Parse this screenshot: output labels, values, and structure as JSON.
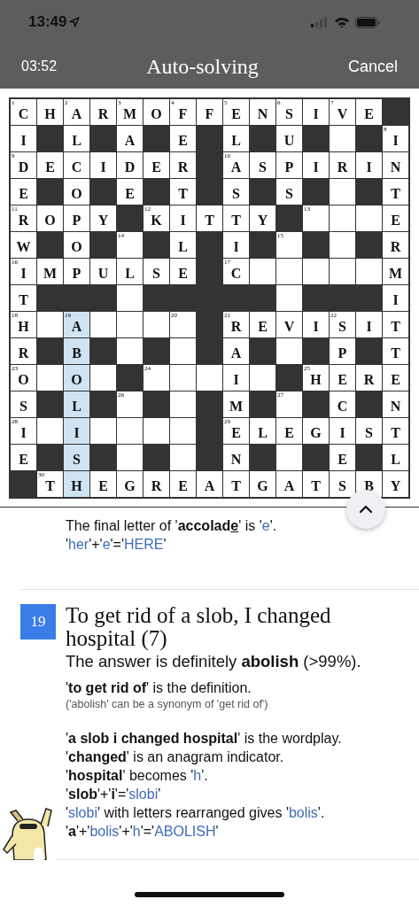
{
  "status_bar": {
    "time": "13:49"
  },
  "nav": {
    "timer": "03:52",
    "title": "Auto-solving",
    "cancel": "Cancel"
  },
  "grid": {
    "rows": [
      [
        {
          "kind": "cell",
          "letter": "C",
          "number": "1",
          "selected": false
        },
        {
          "kind": "cell",
          "letter": "H",
          "selected": false
        },
        {
          "kind": "cell",
          "letter": "A",
          "number": "2",
          "selected": false
        },
        {
          "kind": "cell",
          "letter": "R",
          "selected": false
        },
        {
          "kind": "cell",
          "letter": "M",
          "number": "3",
          "selected": false
        },
        {
          "kind": "cell",
          "letter": "O",
          "selected": false
        },
        {
          "kind": "cell",
          "letter": "F",
          "number": "4",
          "selected": false
        },
        {
          "kind": "cell",
          "letter": "F",
          "selected": false
        },
        {
          "kind": "cell",
          "letter": "E",
          "number": "5",
          "selected": false
        },
        {
          "kind": "cell",
          "letter": "N",
          "selected": false
        },
        {
          "kind": "cell",
          "letter": "S",
          "number": "6",
          "selected": false
        },
        {
          "kind": "cell",
          "letter": "I",
          "selected": false
        },
        {
          "kind": "cell",
          "letter": "V",
          "number": "7",
          "selected": false
        },
        {
          "kind": "cell",
          "letter": "E",
          "selected": false
        },
        {
          "kind": "block"
        }
      ],
      [
        {
          "kind": "cell",
          "letter": "I",
          "selected": false
        },
        {
          "kind": "block"
        },
        {
          "kind": "cell",
          "letter": "L",
          "selected": false
        },
        {
          "kind": "block"
        },
        {
          "kind": "cell",
          "letter": "A",
          "selected": false
        },
        {
          "kind": "block"
        },
        {
          "kind": "cell",
          "letter": "E",
          "selected": false
        },
        {
          "kind": "block"
        },
        {
          "kind": "cell",
          "letter": "L",
          "selected": false
        },
        {
          "kind": "block"
        },
        {
          "kind": "cell",
          "letter": "U",
          "selected": false
        },
        {
          "kind": "block"
        },
        {
          "kind": "cell",
          "selected": false
        },
        {
          "kind": "block"
        },
        {
          "kind": "cell",
          "letter": "I",
          "number": "8",
          "selected": false
        }
      ],
      [
        {
          "kind": "cell",
          "letter": "D",
          "number": "9",
          "selected": false
        },
        {
          "kind": "cell",
          "letter": "E",
          "selected": false
        },
        {
          "kind": "cell",
          "letter": "C",
          "selected": false
        },
        {
          "kind": "cell",
          "letter": "I",
          "selected": false
        },
        {
          "kind": "cell",
          "letter": "D",
          "selected": false
        },
        {
          "kind": "cell",
          "letter": "E",
          "selected": false
        },
        {
          "kind": "cell",
          "letter": "R",
          "selected": false
        },
        {
          "kind": "block"
        },
        {
          "kind": "cell",
          "letter": "A",
          "number": "10",
          "selected": false
        },
        {
          "kind": "cell",
          "letter": "S",
          "selected": false
        },
        {
          "kind": "cell",
          "letter": "P",
          "selected": false
        },
        {
          "kind": "cell",
          "letter": "I",
          "selected": false
        },
        {
          "kind": "cell",
          "letter": "R",
          "selected": false
        },
        {
          "kind": "cell",
          "letter": "I",
          "selected": false
        },
        {
          "kind": "cell",
          "letter": "N",
          "selected": false
        }
      ],
      [
        {
          "kind": "cell",
          "letter": "E",
          "selected": false
        },
        {
          "kind": "block"
        },
        {
          "kind": "cell",
          "letter": "O",
          "selected": false
        },
        {
          "kind": "block"
        },
        {
          "kind": "cell",
          "letter": "E",
          "selected": false
        },
        {
          "kind": "block"
        },
        {
          "kind": "cell",
          "letter": "T",
          "selected": false
        },
        {
          "kind": "block"
        },
        {
          "kind": "cell",
          "letter": "S",
          "selected": false
        },
        {
          "kind": "block"
        },
        {
          "kind": "cell",
          "letter": "S",
          "selected": false
        },
        {
          "kind": "block"
        },
        {
          "kind": "cell",
          "selected": false
        },
        {
          "kind": "block"
        },
        {
          "kind": "cell",
          "letter": "T",
          "selected": false
        }
      ],
      [
        {
          "kind": "cell",
          "letter": "R",
          "number": "11",
          "selected": false
        },
        {
          "kind": "cell",
          "letter": "O",
          "selected": false
        },
        {
          "kind": "cell",
          "letter": "P",
          "selected": false
        },
        {
          "kind": "cell",
          "letter": "Y",
          "selected": false
        },
        {
          "kind": "block"
        },
        {
          "kind": "cell",
          "letter": "K",
          "number": "12",
          "selected": false
        },
        {
          "kind": "cell",
          "letter": "I",
          "selected": false
        },
        {
          "kind": "cell",
          "letter": "T",
          "selected": false
        },
        {
          "kind": "cell",
          "letter": "T",
          "selected": false
        },
        {
          "kind": "cell",
          "letter": "Y",
          "selected": false
        },
        {
          "kind": "block"
        },
        {
          "kind": "cell",
          "number": "13",
          "selected": false
        },
        {
          "kind": "cell",
          "selected": false
        },
        {
          "kind": "cell",
          "selected": false
        },
        {
          "kind": "cell",
          "letter": "E",
          "selected": false
        }
      ],
      [
        {
          "kind": "cell",
          "letter": "W",
          "selected": false
        },
        {
          "kind": "block"
        },
        {
          "kind": "cell",
          "letter": "O",
          "selected": false
        },
        {
          "kind": "block"
        },
        {
          "kind": "cell",
          "number": "14",
          "selected": false
        },
        {
          "kind": "block"
        },
        {
          "kind": "cell",
          "letter": "L",
          "selected": false
        },
        {
          "kind": "block"
        },
        {
          "kind": "cell",
          "letter": "I",
          "selected": false
        },
        {
          "kind": "block"
        },
        {
          "kind": "cell",
          "number": "15",
          "selected": false
        },
        {
          "kind": "block"
        },
        {
          "kind": "cell",
          "selected": false
        },
        {
          "kind": "block"
        },
        {
          "kind": "cell",
          "letter": "R",
          "selected": false
        }
      ],
      [
        {
          "kind": "cell",
          "letter": "I",
          "number": "16",
          "selected": false
        },
        {
          "kind": "cell",
          "letter": "M",
          "selected": false
        },
        {
          "kind": "cell",
          "letter": "P",
          "selected": false
        },
        {
          "kind": "cell",
          "letter": "U",
          "selected": false
        },
        {
          "kind": "cell",
          "letter": "L",
          "selected": false
        },
        {
          "kind": "cell",
          "letter": "S",
          "selected": false
        },
        {
          "kind": "cell",
          "letter": "E",
          "selected": false
        },
        {
          "kind": "block"
        },
        {
          "kind": "cell",
          "letter": "C",
          "number": "17",
          "selected": false
        },
        {
          "kind": "cell",
          "selected": false
        },
        {
          "kind": "cell",
          "selected": false
        },
        {
          "kind": "cell",
          "selected": false
        },
        {
          "kind": "cell",
          "selected": false
        },
        {
          "kind": "cell",
          "selected": false
        },
        {
          "kind": "cell",
          "letter": "M",
          "selected": false
        }
      ],
      [
        {
          "kind": "cell",
          "letter": "T",
          "selected": false
        },
        {
          "kind": "block"
        },
        {
          "kind": "block"
        },
        {
          "kind": "block"
        },
        {
          "kind": "cell",
          "selected": false
        },
        {
          "kind": "block"
        },
        {
          "kind": "block"
        },
        {
          "kind": "block"
        },
        {
          "kind": "block"
        },
        {
          "kind": "block"
        },
        {
          "kind": "cell",
          "selected": false
        },
        {
          "kind": "block"
        },
        {
          "kind": "block"
        },
        {
          "kind": "block"
        },
        {
          "kind": "cell",
          "letter": "I",
          "selected": false
        }
      ],
      [
        {
          "kind": "cell",
          "letter": "H",
          "number": "18",
          "selected": false
        },
        {
          "kind": "cell",
          "selected": false
        },
        {
          "kind": "cell",
          "letter": "A",
          "number": "19",
          "selected": true
        },
        {
          "kind": "cell",
          "selected": false
        },
        {
          "kind": "cell",
          "selected": false
        },
        {
          "kind": "cell",
          "selected": false
        },
        {
          "kind": "cell",
          "number": "20",
          "selected": false
        },
        {
          "kind": "block"
        },
        {
          "kind": "cell",
          "letter": "R",
          "number": "21",
          "selected": false
        },
        {
          "kind": "cell",
          "letter": "E",
          "selected": false
        },
        {
          "kind": "cell",
          "letter": "V",
          "selected": false
        },
        {
          "kind": "cell",
          "letter": "I",
          "selected": false
        },
        {
          "kind": "cell",
          "letter": "S",
          "number": "22",
          "selected": false
        },
        {
          "kind": "cell",
          "letter": "I",
          "selected": false
        },
        {
          "kind": "cell",
          "letter": "T",
          "selected": false
        }
      ],
      [
        {
          "kind": "cell",
          "letter": "R",
          "selected": false
        },
        {
          "kind": "block"
        },
        {
          "kind": "cell",
          "letter": "B",
          "selected": true
        },
        {
          "kind": "block"
        },
        {
          "kind": "cell",
          "selected": false
        },
        {
          "kind": "block"
        },
        {
          "kind": "cell",
          "selected": false
        },
        {
          "kind": "block"
        },
        {
          "kind": "cell",
          "letter": "A",
          "selected": false
        },
        {
          "kind": "block"
        },
        {
          "kind": "cell",
          "selected": false
        },
        {
          "kind": "block"
        },
        {
          "kind": "cell",
          "letter": "P",
          "selected": false
        },
        {
          "kind": "block"
        },
        {
          "kind": "cell",
          "letter": "T",
          "selected": false
        }
      ],
      [
        {
          "kind": "cell",
          "letter": "O",
          "number": "23",
          "selected": false
        },
        {
          "kind": "cell",
          "selected": false
        },
        {
          "kind": "cell",
          "letter": "O",
          "selected": true
        },
        {
          "kind": "cell",
          "selected": false
        },
        {
          "kind": "block"
        },
        {
          "kind": "cell",
          "number": "24",
          "selected": false
        },
        {
          "kind": "cell",
          "selected": false
        },
        {
          "kind": "cell",
          "selected": false
        },
        {
          "kind": "cell",
          "letter": "I",
          "selected": false
        },
        {
          "kind": "cell",
          "selected": false
        },
        {
          "kind": "block"
        },
        {
          "kind": "cell",
          "letter": "H",
          "number": "25",
          "selected": false
        },
        {
          "kind": "cell",
          "letter": "E",
          "selected": false
        },
        {
          "kind": "cell",
          "letter": "R",
          "selected": false
        },
        {
          "kind": "cell",
          "letter": "E",
          "selected": false
        }
      ],
      [
        {
          "kind": "cell",
          "letter": "S",
          "selected": false
        },
        {
          "kind": "block"
        },
        {
          "kind": "cell",
          "letter": "L",
          "selected": true
        },
        {
          "kind": "block"
        },
        {
          "kind": "cell",
          "number": "26",
          "selected": false
        },
        {
          "kind": "block"
        },
        {
          "kind": "cell",
          "selected": false
        },
        {
          "kind": "block"
        },
        {
          "kind": "cell",
          "letter": "M",
          "selected": false
        },
        {
          "kind": "block"
        },
        {
          "kind": "cell",
          "number": "27",
          "selected": false
        },
        {
          "kind": "block"
        },
        {
          "kind": "cell",
          "letter": "C",
          "selected": false
        },
        {
          "kind": "block"
        },
        {
          "kind": "cell",
          "letter": "N",
          "selected": false
        }
      ],
      [
        {
          "kind": "cell",
          "letter": "I",
          "number": "28",
          "selected": false
        },
        {
          "kind": "cell",
          "selected": false
        },
        {
          "kind": "cell",
          "letter": "I",
          "selected": true
        },
        {
          "kind": "cell",
          "selected": false
        },
        {
          "kind": "cell",
          "selected": false
        },
        {
          "kind": "cell",
          "selected": false
        },
        {
          "kind": "cell",
          "selected": false
        },
        {
          "kind": "block"
        },
        {
          "kind": "cell",
          "letter": "E",
          "number": "29",
          "selected": false
        },
        {
          "kind": "cell",
          "letter": "L",
          "selected": false
        },
        {
          "kind": "cell",
          "letter": "E",
          "selected": false
        },
        {
          "kind": "cell",
          "letter": "G",
          "selected": false
        },
        {
          "kind": "cell",
          "letter": "I",
          "selected": false
        },
        {
          "kind": "cell",
          "letter": "S",
          "selected": false
        },
        {
          "kind": "cell",
          "letter": "T",
          "selected": false
        }
      ],
      [
        {
          "kind": "cell",
          "letter": "E",
          "selected": false
        },
        {
          "kind": "block"
        },
        {
          "kind": "cell",
          "letter": "S",
          "selected": true
        },
        {
          "kind": "block"
        },
        {
          "kind": "cell",
          "selected": false
        },
        {
          "kind": "block"
        },
        {
          "kind": "cell",
          "selected": false
        },
        {
          "kind": "block"
        },
        {
          "kind": "cell",
          "letter": "N",
          "selected": false
        },
        {
          "kind": "block"
        },
        {
          "kind": "cell",
          "selected": false
        },
        {
          "kind": "block"
        },
        {
          "kind": "cell",
          "letter": "E",
          "selected": false
        },
        {
          "kind": "block"
        },
        {
          "kind": "cell",
          "letter": "L",
          "selected": false
        }
      ],
      [
        {
          "kind": "block"
        },
        {
          "kind": "cell",
          "letter": "T",
          "number": "30",
          "selected": false
        },
        {
          "kind": "cell",
          "letter": "H",
          "selected": true
        },
        {
          "kind": "cell",
          "letter": "E",
          "selected": false
        },
        {
          "kind": "cell",
          "letter": "G",
          "selected": false
        },
        {
          "kind": "cell",
          "letter": "R",
          "selected": false
        },
        {
          "kind": "cell",
          "letter": "E",
          "selected": false
        },
        {
          "kind": "cell",
          "letter": "A",
          "selected": false
        },
        {
          "kind": "cell",
          "letter": "T",
          "selected": false
        },
        {
          "kind": "cell",
          "letter": "G",
          "selected": false
        },
        {
          "kind": "cell",
          "letter": "A",
          "selected": false
        },
        {
          "kind": "cell",
          "letter": "T",
          "selected": false
        },
        {
          "kind": "cell",
          "letter": "S",
          "selected": false
        },
        {
          "kind": "cell",
          "letter": "B",
          "selected": false
        },
        {
          "kind": "cell",
          "letter": "Y",
          "selected": false
        }
      ]
    ]
  },
  "previous_explanation": {
    "lines": [
      [
        {
          "kind": "text",
          "text": "The final letter of '**accolad**"
        },
        {
          "kind": "marked",
          "text": "e"
        },
        {
          "kind": "text",
          "text": "' is '"
        },
        {
          "kind": "answer",
          "text": "e"
        },
        {
          "kind": "text",
          "text": "'."
        }
      ],
      [
        {
          "kind": "text",
          "text": "'"
        },
        {
          "kind": "answer",
          "text": "her"
        },
        {
          "kind": "text",
          "text": "'+'"
        },
        {
          "kind": "answer",
          "text": "e"
        },
        {
          "kind": "text",
          "text": "'='"
        },
        {
          "kind": "answer",
          "text": "HERE"
        },
        {
          "kind": "text",
          "text": "'"
        }
      ]
    ]
  },
  "clue": {
    "number": "19",
    "text": "To get rid of a slob, I changed hospital (7)",
    "answer_line": "The answer is definitely **abolish** (>99%).",
    "definition": "'**to get rid of**' is the definition.",
    "synonym_note": "('abolish' can be a synonym of 'get rid of')",
    "wordplay": [
      [
        {
          "kind": "text",
          "text": "'**a slob i changed hospital**' is the wordplay."
        }
      ],
      [
        {
          "kind": "text",
          "text": "'**changed**' is an anagram indicator."
        }
      ],
      [
        {
          "kind": "text",
          "text": "'**hospital**' becomes '"
        },
        {
          "kind": "answer",
          "text": "h"
        },
        {
          "kind": "text",
          "text": "'."
        }
      ],
      [
        {
          "kind": "text",
          "text": "'**slob**'+'**i**'='"
        },
        {
          "kind": "answer",
          "text": "slobi"
        },
        {
          "kind": "text",
          "text": "'"
        }
      ],
      [
        {
          "kind": "text",
          "text": "'"
        },
        {
          "kind": "answer",
          "text": "slobi"
        },
        {
          "kind": "text",
          "text": "' with letters rearranged gives '"
        },
        {
          "kind": "answer",
          "text": "bolis"
        },
        {
          "kind": "text",
          "text": "'."
        }
      ],
      [
        {
          "kind": "text",
          "text": "'**a**'+'"
        },
        {
          "kind": "answer",
          "text": "bolis"
        },
        {
          "kind": "text",
          "text": "'+'"
        },
        {
          "kind": "answer",
          "text": "h"
        },
        {
          "kind": "text",
          "text": "'='"
        },
        {
          "kind": "answer",
          "text": "ABOLISH"
        },
        {
          "kind": "text",
          "text": "'"
        }
      ]
    ]
  }
}
